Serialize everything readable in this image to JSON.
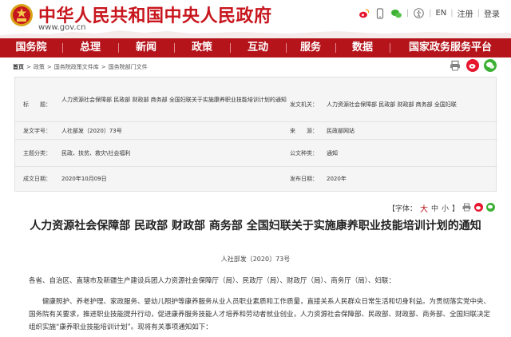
{
  "header": {
    "site_name": "中华人民共和国中央人民政府",
    "site_url": "www.gov.cn",
    "en_label": "EN",
    "mobile_label": "注册",
    "login_label": "登录"
  },
  "nav": {
    "items": [
      "国务院",
      "总理",
      "新闻",
      "政策",
      "互动",
      "服务",
      "数据",
      "国家政务服务平台"
    ]
  },
  "breadcrumb": {
    "items": [
      "首页",
      "政策",
      "国务院政策文件库",
      "国务院部门文件"
    ]
  },
  "info": {
    "title_label": "标　　题：",
    "title_value": "人力资源社会保障部 民政部 财政部 商务部 全国妇联关于实施康养职业技能培训计划的通知",
    "issuer_label": "发文机关：",
    "issuer_value": "人力资源社会保障部 民政部 财政部 商务部 全国妇联",
    "docno_label": "发文字号：",
    "docno_value": "人社部发〔2020〕73号",
    "source_label": "来　　源：",
    "source_value": "民政部网站",
    "topic_label": "主题分类：",
    "topic_value": "民政、扶贫、救灾\\社会福利",
    "type_label": "公文种类：",
    "type_value": "通知",
    "date_label": "成文日期：",
    "date_value": "2020年10月09日",
    "pubdate_label": "发布日期：",
    "pubdate_value": "2020年"
  },
  "fontsize": {
    "label": "【字体：",
    "big": "大",
    "mid": "中",
    "small": "小",
    "end": "】"
  },
  "article": {
    "title": "人力资源社会保障部 民政部 财政部 商务部 全国妇联关于实施康养职业技能培训计划的通知",
    "docno": "人社部发〔2020〕73号",
    "salutation": "各省、自治区、直辖市及新疆生产建设兵团人力资源社会保障厅（局）、民政厅（局）、财政厅（局）、商务厅（局）、妇联：",
    "body": "健康照护、养老护理、家政服务、婴幼儿照护等康养服务从业人员职业素质和工作质量，直接关系人民群众日常生活和切身利益。为贯彻落实党中央、国务院有关要求，推进职业技能提升行动，促进康养服务技能人才培养和劳动者就业创业，人力资源社会保障部、民政部、财政部、商务部、全国妇联决定组织实施“康养职业技能培训计划”。现将有关事项通知如下："
  },
  "colors": {
    "brand_red": "#c8161e",
    "nav_red": "#b5141b"
  }
}
